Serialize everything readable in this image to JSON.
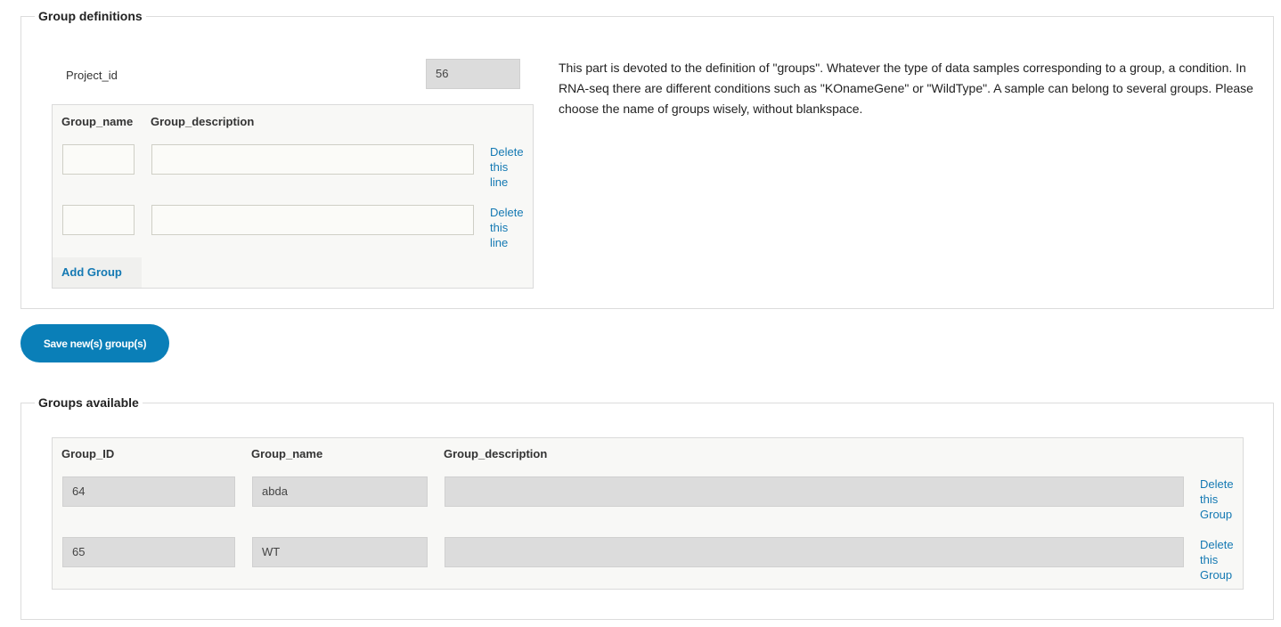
{
  "group_definitions": {
    "legend": "Group definitions",
    "project_id_label": "Project_id",
    "project_id_value": "56",
    "description": "This part is devoted to the definition of \"groups\". Whatever the type of data samples corresponding to a group, a condition. In RNA-seq there are different conditions such as \"KOnameGene\" or \"WildType\". A sample can belong to several groups. Please choose the name of groups wisely, without blankspace.",
    "columns": [
      "Group_name",
      "Group_description"
    ],
    "rows": [
      {
        "name": "",
        "description": "",
        "delete_label": [
          "Delete",
          "this",
          "line"
        ]
      },
      {
        "name": "",
        "description": "",
        "delete_label": [
          "Delete",
          "this",
          "line"
        ]
      }
    ],
    "add_group_label": "Add Group"
  },
  "save_button_label": "Save new(s) group(s)",
  "groups_available": {
    "legend": "Groups available",
    "columns": [
      "Group_ID",
      "Group_name",
      "Group_description"
    ],
    "rows": [
      {
        "id": "64",
        "name": "abda",
        "description": "",
        "delete_label": [
          "Delete",
          "this",
          "Group"
        ]
      },
      {
        "id": "65",
        "name": "WT",
        "description": "",
        "delete_label": [
          "Delete",
          "this",
          "Group"
        ]
      }
    ]
  },
  "colors": {
    "accent": "#0a7fb8",
    "link": "#1479b3"
  }
}
